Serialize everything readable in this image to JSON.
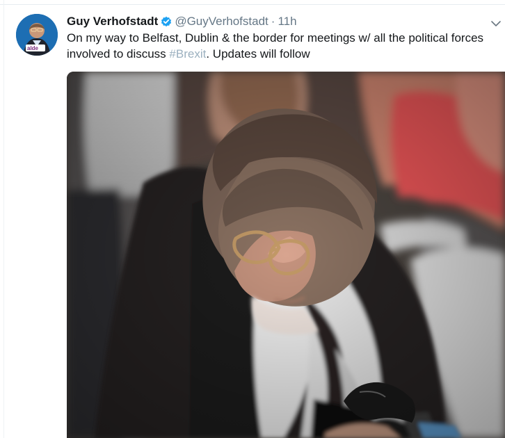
{
  "tweet": {
    "author_name": "Guy Verhofstadt",
    "handle": "@GuyVerhofstadt",
    "separator": "·",
    "time": "11h",
    "text_before": "On my way to Belfast, Dublin & the border for meetings w/ all the political forces involved to discuss ",
    "hashtag_symbol": "#",
    "hashtag_text": "Brexit",
    "text_after": ". Updates will follow",
    "verified": true,
    "avatar_badge": "alde"
  },
  "icons": {
    "verified": "verified-badge-icon",
    "more": "chevron-down-icon"
  },
  "colors": {
    "text": "#14171a",
    "muted": "#657786",
    "verified_blue": "#1da1f2",
    "hashtag": "#9bb0bf",
    "divider": "#e6ecf0"
  }
}
